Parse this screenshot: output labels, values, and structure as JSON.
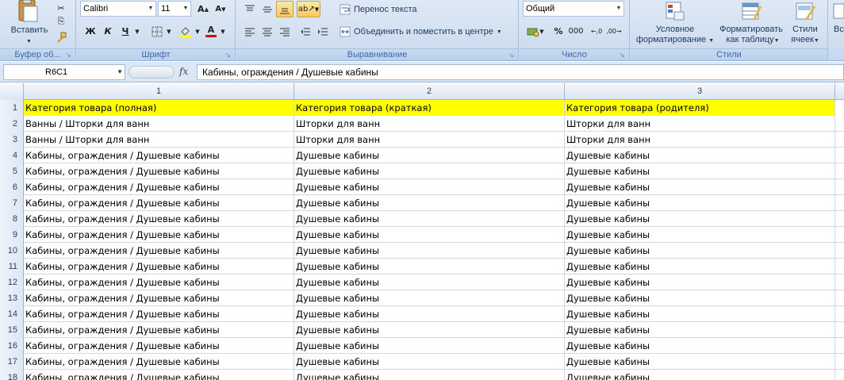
{
  "ribbon": {
    "clipboard": {
      "paste_label": "Вставить",
      "group_label": "Буфер об..."
    },
    "font": {
      "font_name": "Calibri",
      "font_size": "11",
      "bold": "Ж",
      "italic": "К",
      "underline": "Ч",
      "group_label": "Шрифт"
    },
    "alignment": {
      "wrap_text": "Перенос текста",
      "merge_center": "Объединить и поместить в центре",
      "group_label": "Выравнивание"
    },
    "number": {
      "format": "Общий",
      "percent": "%",
      "thousands": "000",
      "group_label": "Число"
    },
    "styles": {
      "conditional_line1": "Условное",
      "conditional_line2": "форматирование",
      "table_line1": "Форматировать",
      "table_line2": "как таблицу",
      "cell_line1": "Стили",
      "cell_line2": "ячеек",
      "group_label": "Стили"
    },
    "cells": {
      "partial_label": "Вс"
    }
  },
  "formula_bar": {
    "name_box": "R6C1",
    "fx": "fx",
    "formula": "Кабины, ограждения / Душевые кабины"
  },
  "grid": {
    "columns": [
      "1",
      "2",
      "3"
    ],
    "rows": [
      {
        "n": "1",
        "c1": "Категория товара (полная)",
        "c2": "Категория товара (краткая)",
        "c3": "Категория товара (родителя)"
      },
      {
        "n": "2",
        "c1": "Ванны / Шторки для ванн",
        "c2": "Шторки для ванн",
        "c3": "Шторки для ванн"
      },
      {
        "n": "3",
        "c1": "Ванны / Шторки для ванн",
        "c2": "Шторки для ванн",
        "c3": "Шторки для ванн"
      },
      {
        "n": "4",
        "c1": "Кабины, ограждения / Душевые кабины",
        "c2": "Душевые кабины",
        "c3": "Душевые кабины"
      },
      {
        "n": "5",
        "c1": "Кабины, ограждения / Душевые кабины",
        "c2": "Душевые кабины",
        "c3": "Душевые кабины"
      },
      {
        "n": "6",
        "c1": "Кабины, ограждения / Душевые кабины",
        "c2": "Душевые кабины",
        "c3": "Душевые кабины"
      },
      {
        "n": "7",
        "c1": "Кабины, ограждения / Душевые кабины",
        "c2": "Душевые кабины",
        "c3": "Душевые кабины"
      },
      {
        "n": "8",
        "c1": "Кабины, ограждения / Душевые кабины",
        "c2": "Душевые кабины",
        "c3": "Душевые кабины"
      },
      {
        "n": "9",
        "c1": "Кабины, ограждения / Душевые кабины",
        "c2": "Душевые кабины",
        "c3": "Душевые кабины"
      },
      {
        "n": "10",
        "c1": "Кабины, ограждения / Душевые кабины",
        "c2": "Душевые кабины",
        "c3": "Душевые кабины"
      },
      {
        "n": "11",
        "c1": "Кабины, ограждения / Душевые кабины",
        "c2": "Душевые кабины",
        "c3": "Душевые кабины"
      },
      {
        "n": "12",
        "c1": "Кабины, ограждения / Душевые кабины",
        "c2": "Душевые кабины",
        "c3": "Душевые кабины"
      },
      {
        "n": "13",
        "c1": "Кабины, ограждения / Душевые кабины",
        "c2": "Душевые кабины",
        "c3": "Душевые кабины"
      },
      {
        "n": "14",
        "c1": "Кабины, ограждения / Душевые кабины",
        "c2": "Душевые кабины",
        "c3": "Душевые кабины"
      },
      {
        "n": "15",
        "c1": "Кабины, ограждения / Душевые кабины",
        "c2": "Душевые кабины",
        "c3": "Душевые кабины"
      },
      {
        "n": "16",
        "c1": "Кабины, ограждения / Душевые кабины",
        "c2": "Душевые кабины",
        "c3": "Душевые кабины"
      },
      {
        "n": "17",
        "c1": "Кабины, ограждения / Душевые кабины",
        "c2": "Душевые кабины",
        "c3": "Душевые кабины"
      },
      {
        "n": "18",
        "c1": "Кабины, ограждения / Душевые кабины",
        "c2": "Душевые кабины",
        "c3": "Душевые кабины"
      }
    ],
    "header_fill": "#ffff00"
  }
}
